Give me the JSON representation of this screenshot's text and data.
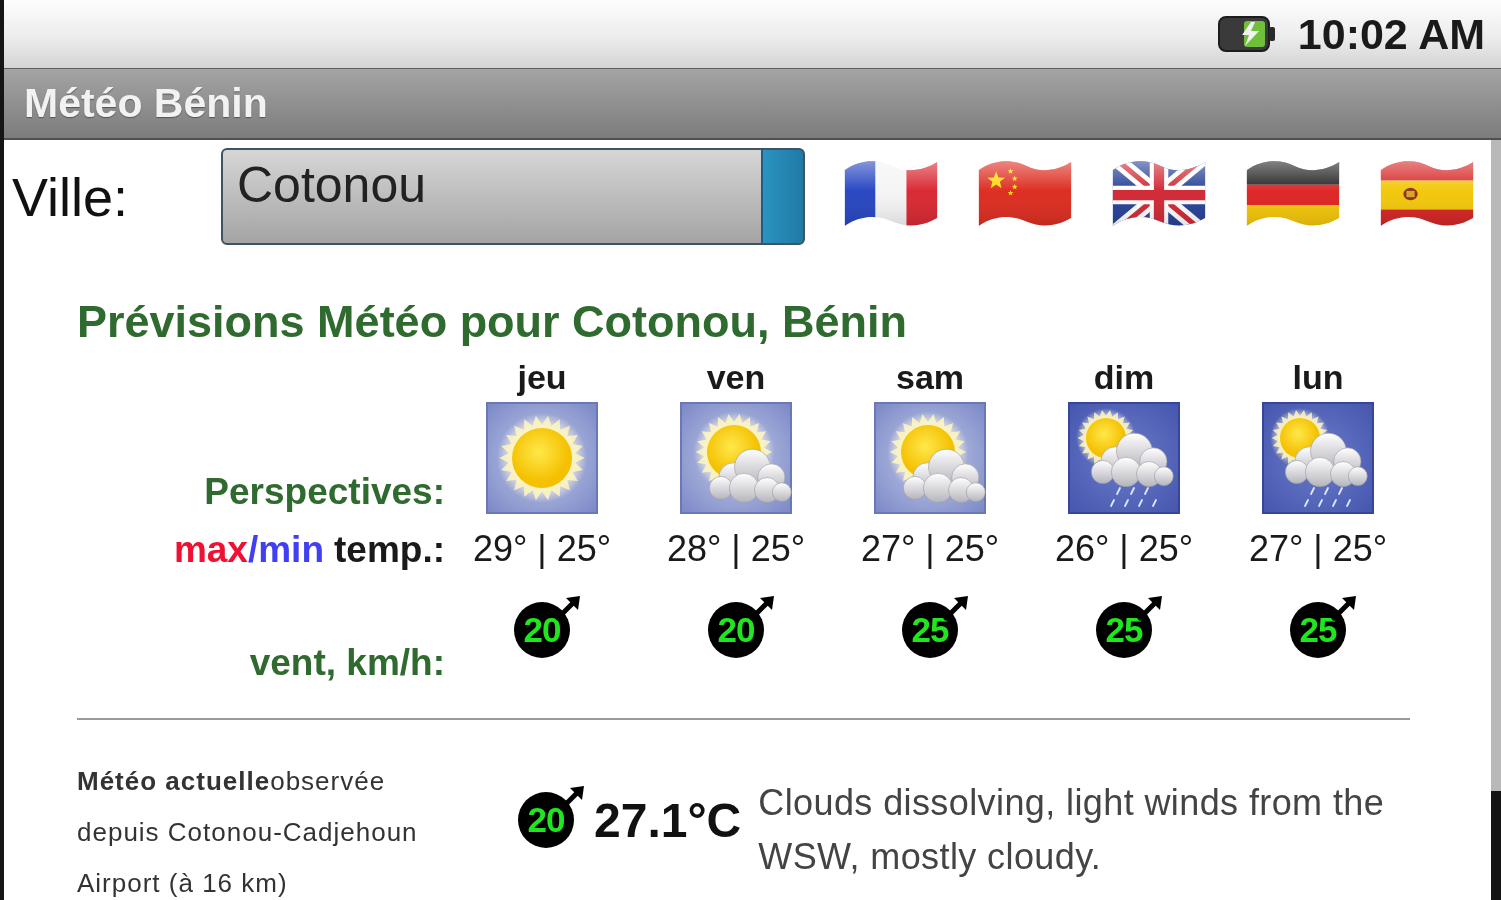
{
  "status_bar": {
    "time": "10:02 AM"
  },
  "app_bar": {
    "title": "Météo Bénin"
  },
  "city": {
    "label": "Ville:",
    "value": "Cotonou"
  },
  "forecast": {
    "title": "Prévisions Météo pour Cotonou, Bénin",
    "row_labels": {
      "outlook": "Perspectives:",
      "temperature": [
        {
          "kind": "max",
          "text": "max"
        },
        {
          "kind": "min",
          "text": "/min"
        },
        {
          "kind": "plain",
          "text": "temp.:"
        }
      ],
      "wind": "vent, km/h:"
    },
    "days": [
      {
        "name": "jeu",
        "kind": "sun",
        "temperature": "29° | 25°",
        "wind": "20"
      },
      {
        "name": "ven",
        "kind": "sun_cloud",
        "temperature": "28° | 25°",
        "wind": "20"
      },
      {
        "name": "sam",
        "kind": "sun_cloud",
        "temperature": "27° | 25°",
        "wind": "25"
      },
      {
        "name": "dim",
        "kind": "sun_cloud_rain",
        "temperature": "26° | 25°",
        "wind": "25"
      },
      {
        "name": "lun",
        "kind": "sun_cloud_rain",
        "temperature": "27° | 25°",
        "wind": "25"
      }
    ]
  },
  "current": {
    "source": "**Météo actuelle**observée depuis Cotonou-Cadjehoun Airport (à 16 km)",
    "wind": "20",
    "temperature": "27.1°C",
    "description": "Clouds dissolving, light winds from the WSW, mostly cloudy."
  }
}
